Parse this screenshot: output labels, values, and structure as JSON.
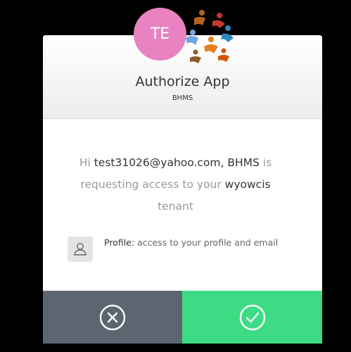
{
  "card": {
    "app_name": "Authorize App",
    "client_name": "BHMS"
  },
  "user": {
    "initials": "TE",
    "avatar_color": "#e882c0"
  },
  "message": {
    "greeting": "Hi ",
    "email": "test31026@yahoo.com",
    "separator": ", ",
    "client": "BHMS",
    "requesting": " is requesting access to your ",
    "tenant": "wyowcis",
    "suffix": " tenant"
  },
  "scopes": [
    {
      "name": "Profile:",
      "description": " access to your profile and email",
      "icon": "user-icon"
    }
  ],
  "actions": {
    "deny_icon": "close-circle-icon",
    "accept_icon": "check-circle-icon",
    "deny_color": "#5c6670",
    "accept_color": "#3ddc84"
  },
  "colors": {
    "background": "#000000",
    "card": "#ffffff",
    "highlight_text": "#333333",
    "muted_text": "#999999"
  }
}
